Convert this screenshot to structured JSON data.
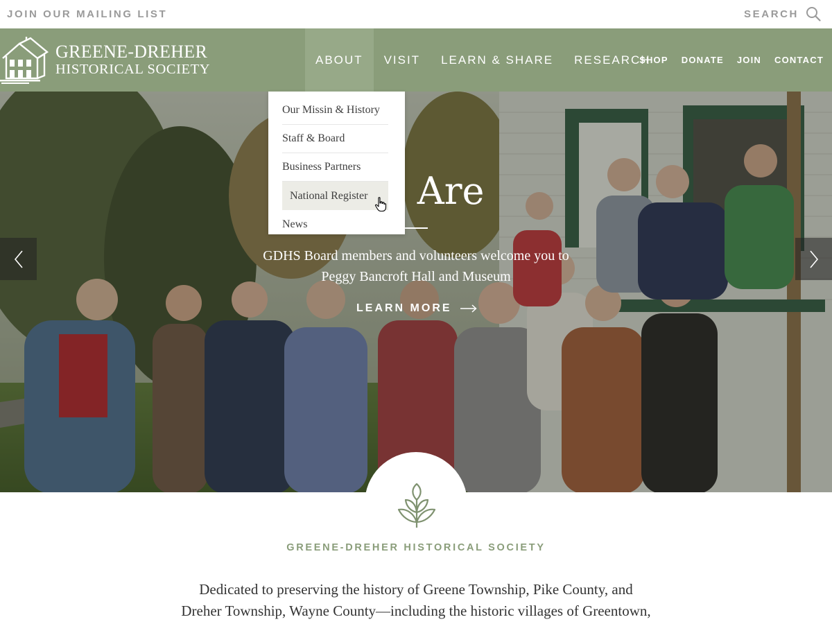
{
  "topbar": {
    "mailing_label": "JOIN OUR MAILING LIST",
    "search_label": "SEARCH"
  },
  "logo": {
    "line1": "GREENE-DREHER",
    "line2": "HISTORICAL SOCIETY"
  },
  "nav": {
    "main": [
      "ABOUT",
      "VISIT",
      "LEARN & SHARE",
      "RESEARCH"
    ],
    "active": "ABOUT",
    "secondary": [
      "SHOP",
      "DONATE",
      "JOIN",
      "CONTACT"
    ]
  },
  "dropdown": {
    "items": [
      "Our Missin & History",
      "Staff & Board",
      "Business Partners",
      "National Register",
      "News"
    ],
    "hovered": "National Register"
  },
  "hero": {
    "title_visible": "We Are",
    "caption_line1": "GDHS Board members and volunteers welcome you to",
    "caption_line2": "Peggy Bancroft Hall and Museum",
    "cta_label": "LEARN MORE"
  },
  "intro": {
    "org_name": "GREENE-DREHER HISTORICAL SOCIETY",
    "text_line1": "Dedicated to preserving the history of Greene Township, Pike County, and",
    "text_line2": "Dreher Township, Wayne County—including the historic villages of Greentown,"
  },
  "colors": {
    "nav_green": "#8a9d7a",
    "nav_active": "#97a988",
    "utility_gray": "#9a9a9a",
    "accent_green": "#8a9d7a"
  },
  "icons": [
    "search-icon",
    "house-logo-icon",
    "chevron-left-icon",
    "chevron-right-icon",
    "arrow-right-icon",
    "hand-cursor-icon",
    "leaf-icon"
  ]
}
